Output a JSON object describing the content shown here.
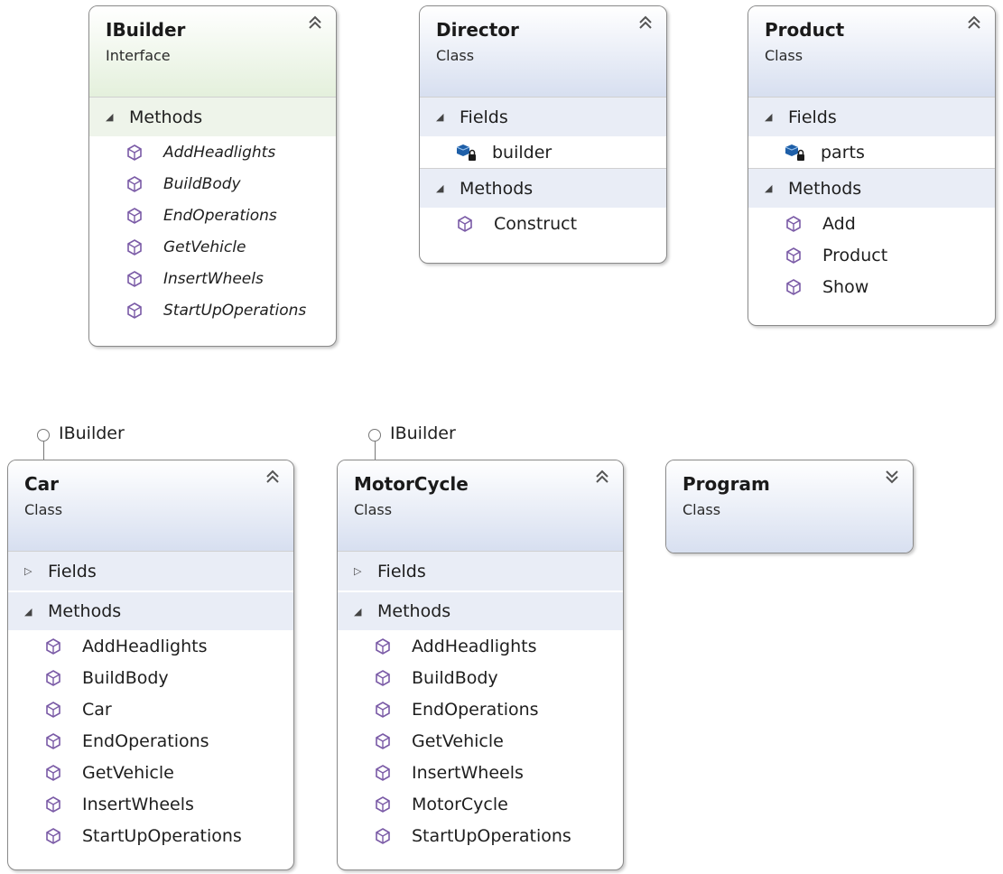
{
  "interfaces": [
    {
      "name": "IBuilder",
      "stereotype": "Interface",
      "expanded": true,
      "methods_label": "Methods",
      "methods": [
        "AddHeadlights",
        "BuildBody",
        "EndOperations",
        "GetVehicle",
        "InsertWheels",
        "StartUpOperations"
      ]
    }
  ],
  "classes": {
    "director": {
      "name": "Director",
      "stereotype": "Class",
      "fields_label": "Fields",
      "fields": [
        "builder"
      ],
      "methods_label": "Methods",
      "methods": [
        "Construct"
      ]
    },
    "product": {
      "name": "Product",
      "stereotype": "Class",
      "fields_label": "Fields",
      "fields": [
        "parts"
      ],
      "methods_label": "Methods",
      "methods": [
        "Add",
        "Product",
        "Show"
      ]
    },
    "car": {
      "name": "Car",
      "stereotype": "Class",
      "implements": "IBuilder",
      "fields_label": "Fields",
      "fields_collapsed": true,
      "methods_label": "Methods",
      "methods": [
        "AddHeadlights",
        "BuildBody",
        "Car",
        "EndOperations",
        "GetVehicle",
        "InsertWheels",
        "StartUpOperations"
      ]
    },
    "motorcycle": {
      "name": "MotorCycle",
      "stereotype": "Class",
      "implements": "IBuilder",
      "fields_label": "Fields",
      "fields_collapsed": true,
      "methods_label": "Methods",
      "methods": [
        "AddHeadlights",
        "BuildBody",
        "EndOperations",
        "GetVehicle",
        "InsertWheels",
        "MotorCycle",
        "StartUpOperations"
      ]
    },
    "program": {
      "name": "Program",
      "stereotype": "Class",
      "collapsed": true
    }
  },
  "colors": {
    "interface_header": "#e4f0dc",
    "class_header": "#d7dff0",
    "method_icon": "#7a5aa6",
    "field_icon": "#1e5fa8",
    "border": "#8a8a8a"
  },
  "icons": {
    "expanded_toggle": "double-chevron-up-icon",
    "collapsed_toggle": "double-chevron-down-icon",
    "method": "method-cube-icon",
    "field": "private-field-icon",
    "lollipop": "interface-lollipop-icon"
  }
}
